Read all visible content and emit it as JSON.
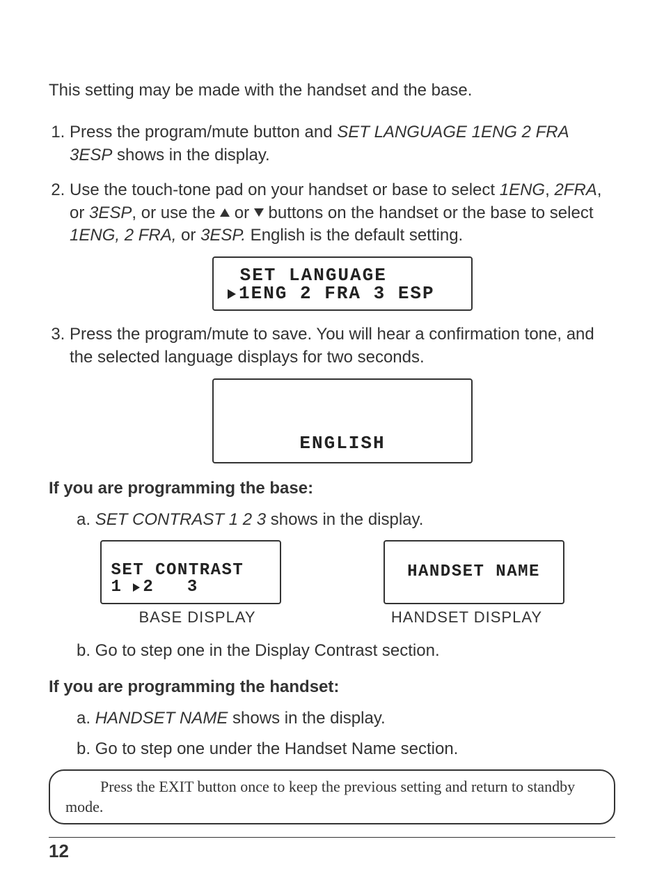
{
  "intro": "This setting may be made with the handset and the base.",
  "steps": {
    "s1_a": "Press the program/mute button and ",
    "s1_i": "SET LANGUAGE 1ENG 2 FRA 3ESP",
    "s1_b": " shows in the display.",
    "s2_a": "Use the touch-tone pad on your handset or base to select ",
    "s2_i1": "1ENG",
    "s2_c1": ", ",
    "s2_i2": "2FRA",
    "s2_c2": ", or ",
    "s2_i3": "3ESP",
    "s2_mid": ", or use the ",
    "s2_mid2": " or ",
    "s2_mid3": " buttons on the handset or the base to select ",
    "s2_i4": "1ENG, 2 FRA,",
    "s2_c3": " or ",
    "s2_i5": "3ESP.",
    "s2_end": "  English is the default setting.",
    "s3": "Press the program/mute to save. You will hear a confirmation tone, and the selected language displays for two seconds."
  },
  "lcd1": {
    "line1": " SET LANGUAGE",
    "line2": "1ENG 2 FRA 3 ESP"
  },
  "lcd2": "ENGLISH",
  "base_heading": "If you are programming the base:",
  "base_a_1": "a. ",
  "base_a_i": "SET CONTRAST 1 2 3",
  "base_a_2": " shows in the display.",
  "lcd_contrast": {
    "line1": "SET CONTRAST",
    "line2_pre": "1 ",
    "line2_post": "2   3"
  },
  "lcd_handset_name": "HANDSET NAME",
  "caption_base": "BASE DISPLAY",
  "caption_handset": "HANDSET DISPLAY",
  "base_b": "b. Go to step one in the Display Contrast section.",
  "hs_heading": "If you are programming the handset:",
  "hs_a_1": "a. ",
  "hs_a_i": "HANDSET NAME",
  "hs_a_2": " shows in the display.",
  "hs_b": "b. Go to step one under the Handset Name section.",
  "tip": "Press the EXIT button once to keep the previous setting and return to standby mode.",
  "page_number": "12"
}
